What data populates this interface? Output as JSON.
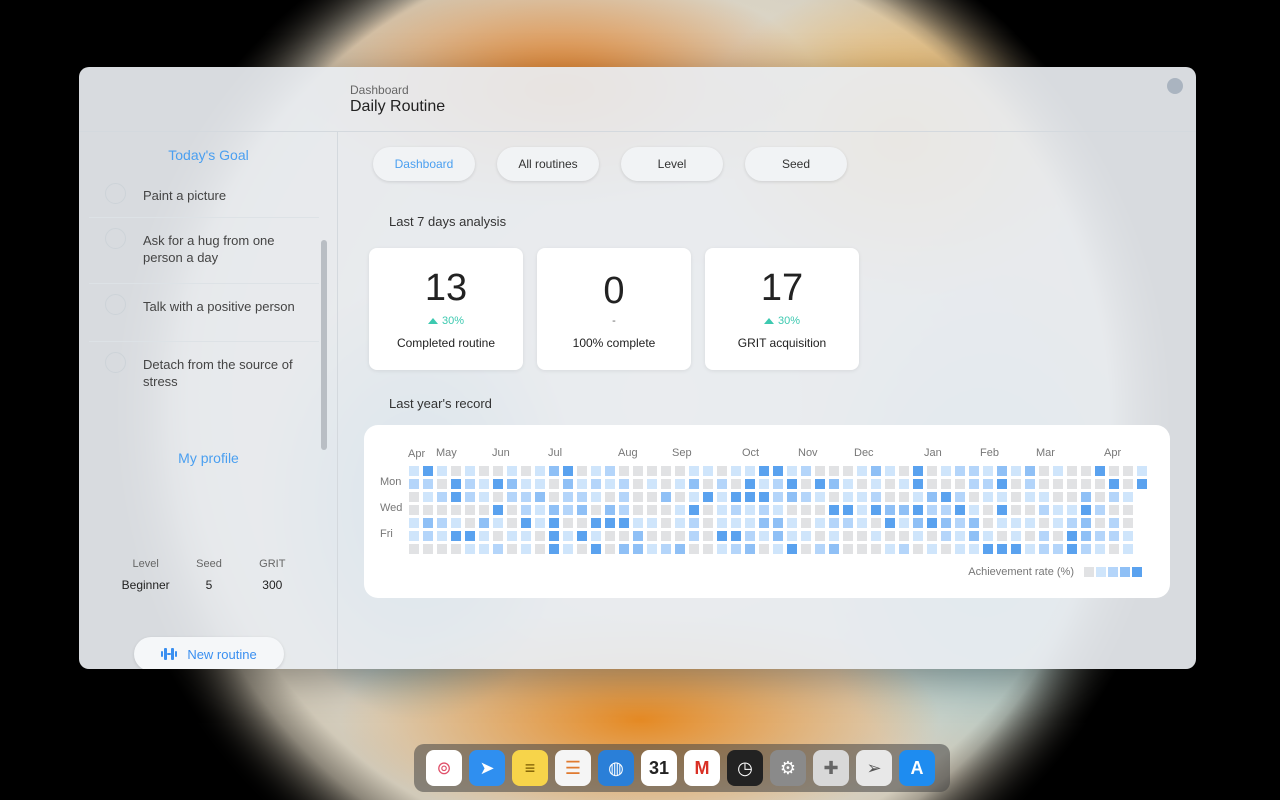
{
  "window": {
    "breadcrumb": "Dashboard",
    "title": "Daily Routine"
  },
  "sidebar": {
    "goal_title": "Today's Goal",
    "goals": [
      {
        "label": "Paint a picture"
      },
      {
        "label": "Ask for a hug from one person a day"
      },
      {
        "label": "Talk with a positive person"
      },
      {
        "label": "Detach from the source of stress"
      }
    ],
    "profile_title": "My profile",
    "profile": [
      {
        "label": "Level",
        "value": "Beginner"
      },
      {
        "label": "Seed",
        "value": "5"
      },
      {
        "label": "GRIT",
        "value": "300"
      }
    ],
    "new_routine_label": "New routine"
  },
  "tabs": [
    {
      "label": "Dashboard",
      "active": true
    },
    {
      "label": "All routines",
      "active": false
    },
    {
      "label": "Level",
      "active": false
    },
    {
      "label": "Seed",
      "active": false
    }
  ],
  "analysis": {
    "title": "Last 7 days analysis",
    "cards": [
      {
        "value": "13",
        "delta": "30%",
        "label": "Completed routine"
      },
      {
        "value": "0",
        "delta": "-",
        "label": "100% complete"
      },
      {
        "value": "17",
        "delta": "30%",
        "label": "GRIT acquisition"
      }
    ]
  },
  "record": {
    "title": "Last year's record",
    "months": [
      "Apr",
      "May",
      "Jun",
      "Jul",
      "Aug",
      "Sep",
      "Oct",
      "Nov",
      "Dec",
      "Jan",
      "Feb",
      "Mar",
      "Apr"
    ],
    "days": [
      "Mon",
      "Wed",
      "Fri"
    ],
    "legend_label": "Achievement rate (%)",
    "colors": [
      "#e1e2e4",
      "#cfe5fb",
      "#b4d5fa",
      "#8fc0f6",
      "#5aa2ef"
    ]
  },
  "dock": {
    "apps": [
      {
        "name": "touch-id",
        "glyph": "⊚",
        "bg": "#ffffff",
        "fg": "#e0506a"
      },
      {
        "name": "safari",
        "glyph": "➤",
        "bg": "#2f8ff0",
        "fg": "#ffffff"
      },
      {
        "name": "notes",
        "glyph": "≡",
        "bg": "#f7d44a",
        "fg": "#7a5a00"
      },
      {
        "name": "reminders",
        "glyph": "☰",
        "bg": "#f5f5f5",
        "fg": "#e07a30"
      },
      {
        "name": "network",
        "glyph": "◍",
        "bg": "#2a7fd8",
        "fg": "#ffffff"
      },
      {
        "name": "calendar",
        "glyph": "31",
        "bg": "#ffffff",
        "fg": "#222222"
      },
      {
        "name": "gmail",
        "glyph": "M",
        "bg": "#ffffff",
        "fg": "#d93025"
      },
      {
        "name": "clock",
        "glyph": "◷",
        "bg": "#222222",
        "fg": "#ffffff"
      },
      {
        "name": "system-preferences",
        "glyph": "⚙",
        "bg": "#8a8a8a",
        "fg": "#ffffff"
      },
      {
        "name": "extensions",
        "glyph": "✚",
        "bg": "#d8d8d8",
        "fg": "#666666"
      },
      {
        "name": "send",
        "glyph": "➢",
        "bg": "#e8e8e8",
        "fg": "#555555"
      },
      {
        "name": "app-store",
        "glyph": "A",
        "bg": "#1e8cf0",
        "fg": "#ffffff"
      }
    ]
  }
}
